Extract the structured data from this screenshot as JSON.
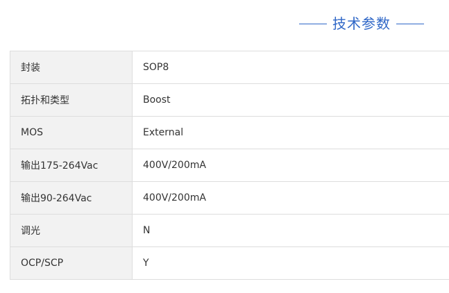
{
  "section": {
    "title": "技术参数"
  },
  "specs": {
    "rows": [
      {
        "label": "封装",
        "value": "SOP8"
      },
      {
        "label": "拓扑和类型",
        "value": "Boost"
      },
      {
        "label": "MOS",
        "value": "External"
      },
      {
        "label": "输出175-264Vac",
        "value": "400V/200mA"
      },
      {
        "label": "输出90-264Vac",
        "value": "400V/200mA"
      },
      {
        "label": "调光",
        "value": "N"
      },
      {
        "label": "OCP/SCP",
        "value": "Y"
      }
    ]
  },
  "colors": {
    "accent": "#2f67c7",
    "label_bg": "#f2f2f2",
    "border": "#dddddd",
    "text": "#333333"
  }
}
